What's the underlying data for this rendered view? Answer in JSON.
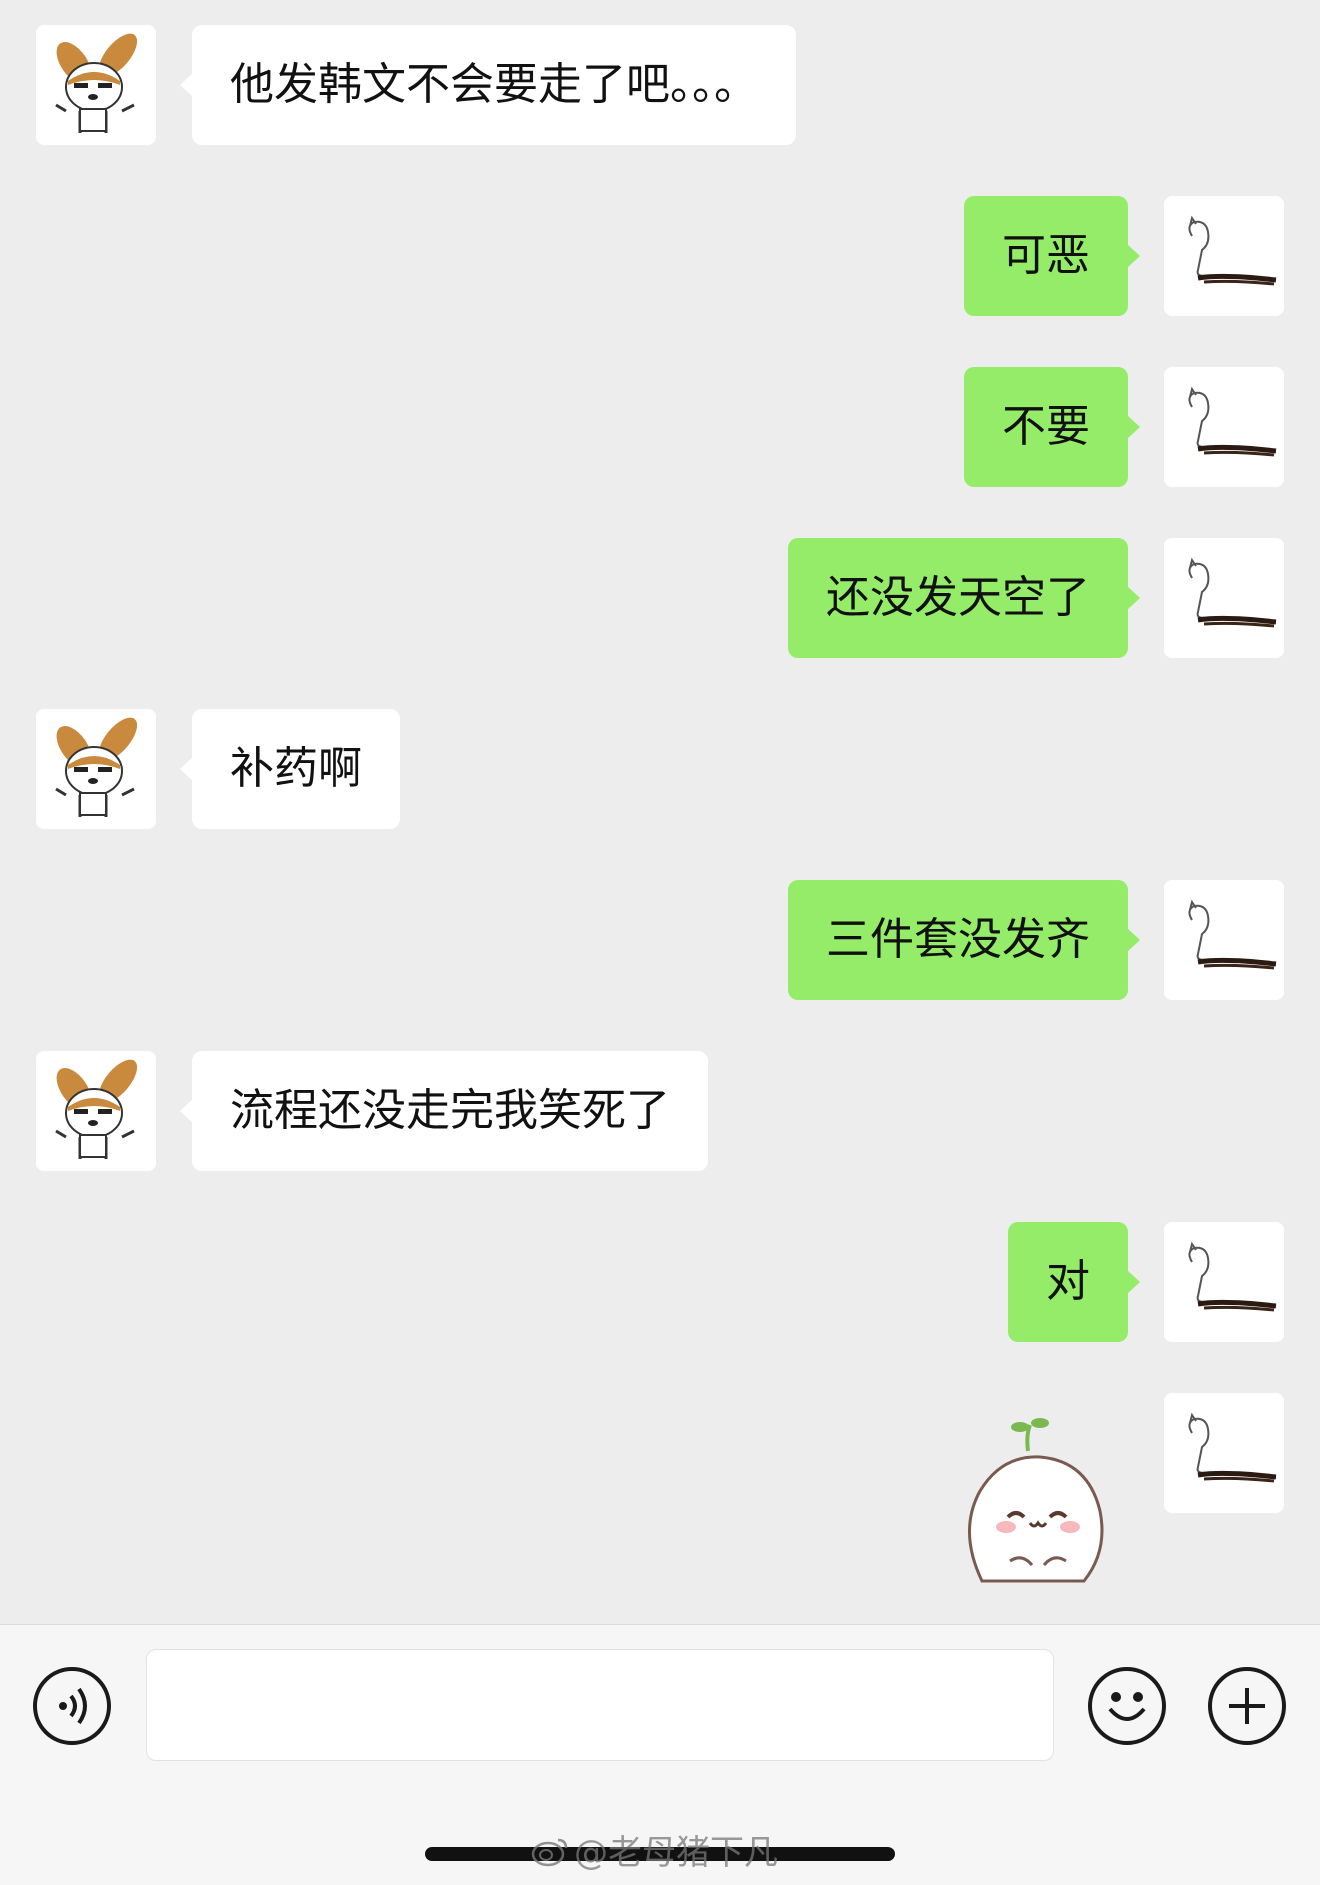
{
  "messages": [
    {
      "side": "in",
      "text": "他发韩文不会要走了吧。。。"
    },
    {
      "side": "out",
      "text": "可恶"
    },
    {
      "side": "out",
      "text": "不要"
    },
    {
      "side": "out",
      "text": "还没发天空了"
    },
    {
      "side": "in",
      "text": "补药啊"
    },
    {
      "side": "out",
      "text": "三件套没发齐"
    },
    {
      "side": "in",
      "text": "流程还没走完我笑死了"
    },
    {
      "side": "out",
      "text": "对"
    }
  ],
  "sticker_message": {
    "side": "out",
    "sticker": "smiling-dumpling-sticker"
  },
  "avatars": {
    "contact": "cartoon-dog-avatar",
    "self": "sketch-figure-avatar"
  },
  "input_bar": {
    "voice_icon": "voice-icon",
    "emoji_icon": "emoji-icon",
    "plus_icon": "plus-icon",
    "input_value": ""
  },
  "watermark": {
    "text": "@老母猪下凡",
    "icon": "weibo-icon"
  },
  "colors": {
    "background": "#ededed",
    "incoming_bubble": "#ffffff",
    "outgoing_bubble": "#95ec69",
    "input_bar": "#f6f6f6"
  }
}
